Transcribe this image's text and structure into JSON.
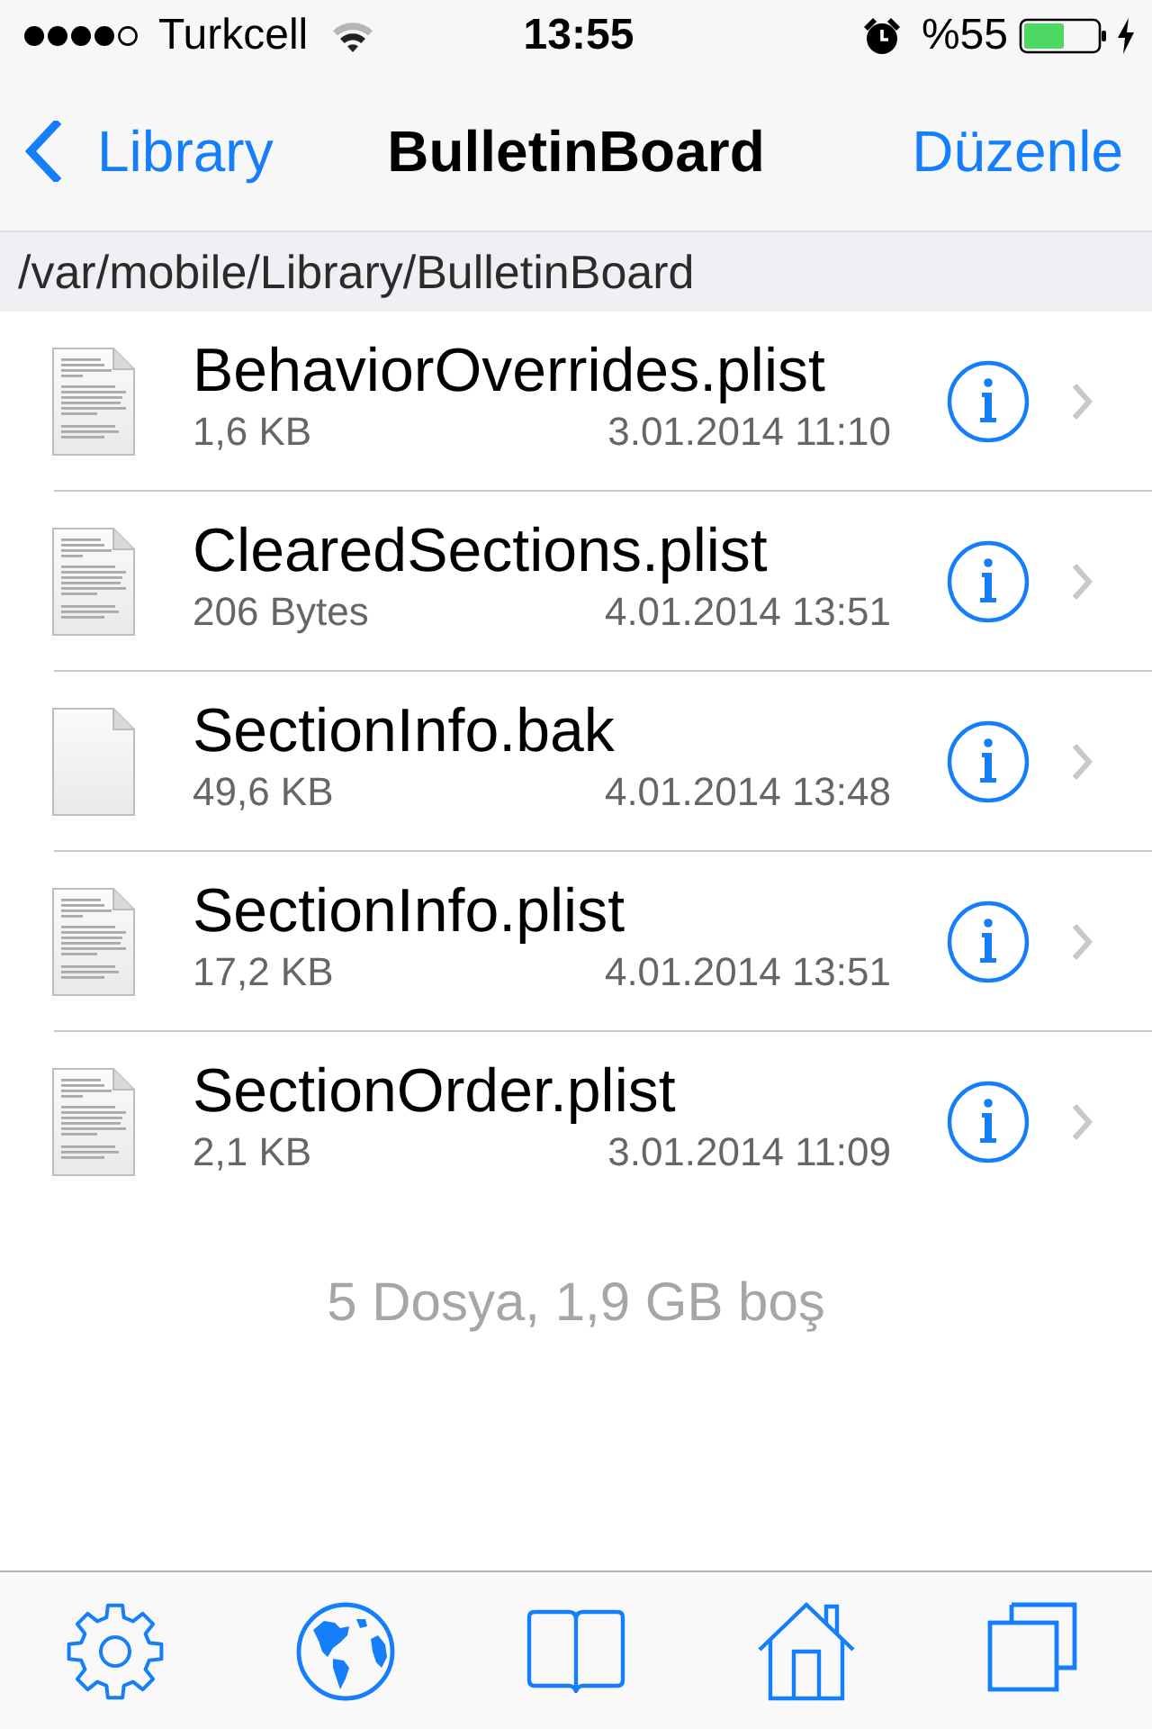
{
  "status_bar": {
    "carrier": "Turkcell",
    "time": "13:55",
    "battery": "%55"
  },
  "nav_bar": {
    "back": "Library",
    "title": "BulletinBoard",
    "action": "Düzenle"
  },
  "path": "/var/mobile/Library/BulletinBoard",
  "files": [
    {
      "name": "BehaviorOverrides.plist",
      "size": "1,6 KB",
      "date": "3.01.2014 11:10",
      "kind": "text"
    },
    {
      "name": "ClearedSections.plist",
      "size": "206 Bytes",
      "date": "4.01.2014 13:51",
      "kind": "text"
    },
    {
      "name": "SectionInfo.bak",
      "size": "49,6 KB",
      "date": "4.01.2014 13:48",
      "kind": "blank"
    },
    {
      "name": "SectionInfo.plist",
      "size": "17,2 KB",
      "date": "4.01.2014 13:51",
      "kind": "text"
    },
    {
      "name": "SectionOrder.plist",
      "size": "2,1 KB",
      "date": "3.01.2014 11:09",
      "kind": "text"
    }
  ],
  "footer": "5 Dosya, 1,9 GB boş"
}
